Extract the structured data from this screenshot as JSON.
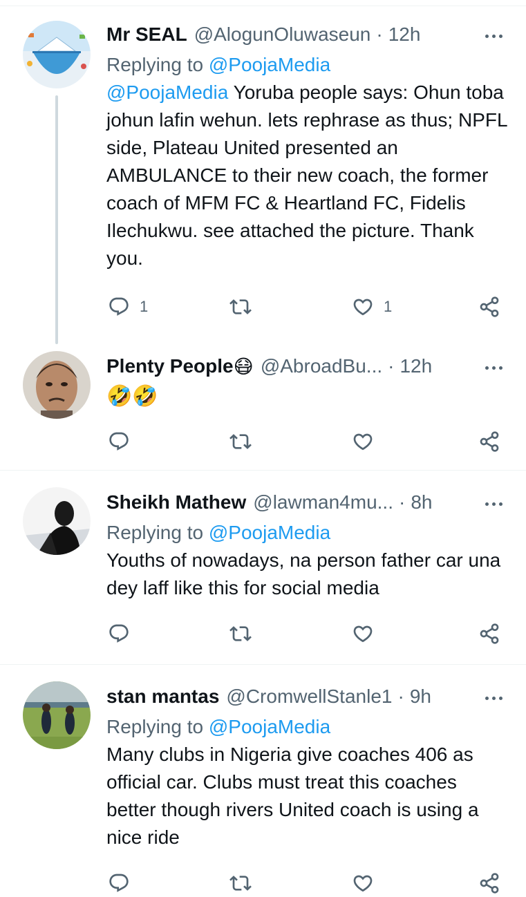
{
  "colors": {
    "link": "#1d9bf0",
    "secondary": "#536471",
    "text": "#0f1419",
    "divider": "#eff3f4"
  },
  "tweets": [
    {
      "name": "Mr SEAL",
      "handle": "@AlogunOluwaseun",
      "dot": "·",
      "time": "12h",
      "replying_prefix": "Replying to ",
      "replying_to": "@PoojaMedia",
      "mention": "@PoojaMedia",
      "text": " Yoruba people says: Ohun toba johun lafin wehun. lets rephrase as thus; NPFL side, Plateau United presented an AMBULANCE to their new coach, the former coach of MFM FC & Heartland FC, Fidelis Ilechukwu. see attached the picture. Thank you.",
      "reply_count": "1",
      "like_count": "1",
      "icons": [
        "reply-icon",
        "retweet-icon",
        "like-icon",
        "share-icon",
        "more-icon"
      ]
    },
    {
      "name": "Plenty People",
      "name_emoji": "😷",
      "handle": "@AbroadBu...",
      "dot": "·",
      "time": "12h",
      "text": "🤣🤣"
    },
    {
      "name": "Sheikh Mathew",
      "handle": "@lawman4mu...",
      "dot": "·",
      "time": "8h",
      "replying_prefix": "Replying to ",
      "replying_to": "@PoojaMedia",
      "text": "Youths of nowadays, na person father car una dey laff like this for social media"
    },
    {
      "name": "stan mantas",
      "handle": "@CromwellStanle1",
      "dot": "·",
      "time": "9h",
      "replying_prefix": "Replying to ",
      "replying_to": "@PoojaMedia",
      "text": "Many clubs in Nigeria give coaches 406 as official car. Clubs must treat this coaches better though rivers United coach is using a nice ride"
    }
  ]
}
